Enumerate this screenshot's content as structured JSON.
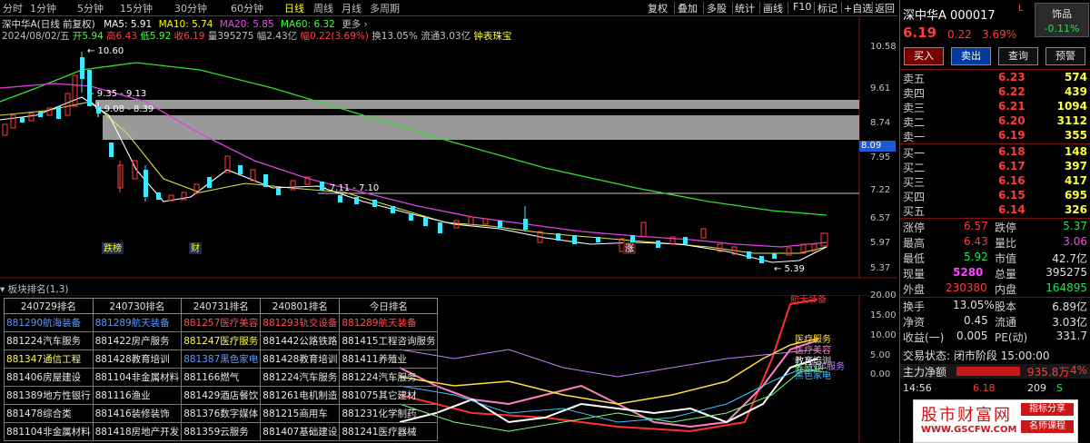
{
  "period_tabs": [
    "分时",
    "1分钟",
    "5分钟",
    "15分钟",
    "30分钟",
    "60分钟",
    "日线",
    "周线",
    "月线",
    "多周期"
  ],
  "active_period": "日线",
  "right_tools": [
    "复权",
    "叠加",
    "多股",
    "统计",
    "画线",
    "F10",
    "标记",
    "+自选",
    "返回"
  ],
  "header": {
    "title": "深中华A(日线 前复权)",
    "ma5": "MA5: 5.91",
    "ma10": "MA10: 5.74",
    "ma20": "MA20: 5.85",
    "ma60": "MA60: 6.32",
    "date": "2024/08/02/五",
    "open": "开5.94",
    "high": "高6.43",
    "low": "低5.92",
    "close": "收6.19",
    "vol": "量395275",
    "amp": "幅2.43亿",
    "chg": "幅0.22(3.69%)",
    "turnover": "换13.05%",
    "float": "流通3.03亿",
    "sector": "钟表珠宝"
  },
  "price_axis": [
    "10.58",
    "9.61",
    "8.74",
    "7.95",
    "7.22",
    "6.57",
    "5.97",
    "5.37"
  ],
  "current_price_tag": "8.09",
  "annotations": {
    "high_label": "10.60",
    "gap1": "9.35 - 9.13",
    "gap2": "9.08 - 8.39",
    "gap3": "7.11 - 7.10",
    "low_label": "5.39"
  },
  "markers": [
    "跌榜",
    "财",
    "涨"
  ],
  "lower_title": "板块排名(1,3)",
  "lower_axis": [
    "20.00",
    "15.00",
    "10.00",
    "5.00",
    "0.00"
  ],
  "rank_table": {
    "headers": [
      "240729排名",
      "240730排名",
      "240731排名",
      "240801排名",
      "今日排名"
    ],
    "rows": [
      [
        "881290航海装备",
        "881289航天装备",
        "881257医疗美容",
        "881293轨交设备",
        "881289航天装备"
      ],
      [
        "881224汽车服务",
        "881422房产服务",
        "881247医疗服务",
        "881442公路铁路",
        "881415工程咨询服务"
      ],
      [
        "881347通信工程",
        "881428教育培训",
        "881387黑色家电",
        "881428教育培训",
        "881411养殖业"
      ],
      [
        "881406房屋建设",
        "881104非金属材料",
        "881166燃气",
        "881224汽车服务",
        "881224汽车服务"
      ],
      [
        "881389地方性银行",
        "881116渔业",
        "881429酒店餐饮",
        "881261电机制造",
        "881075其它建材"
      ],
      [
        "881478综合类",
        "881416装修装饰",
        "881376数字媒体",
        "881215商用车",
        "881231化学制药"
      ],
      [
        "881104非金属材料",
        "881418房地产开发",
        "881359云服务",
        "881407基础建设",
        "881241医疗器械"
      ]
    ]
  },
  "line_labels": [
    "航天装备",
    "医疗服务",
    "医疗美容",
    "教育培训",
    "养殖业",
    "汽车服务",
    "黑色家电"
  ],
  "quote": {
    "name": "深中华A",
    "code": "000017",
    "flag": "L",
    "sector_name": "饰品",
    "sector_chg": "-0.11%",
    "price": "6.19",
    "change": "0.22",
    "pct": "3.69%",
    "buttons": [
      "买入",
      "卖出",
      "查询",
      "预警"
    ],
    "asks": [
      {
        "label": "卖五",
        "price": "6.23",
        "vol": "574"
      },
      {
        "label": "卖四",
        "price": "6.22",
        "vol": "439"
      },
      {
        "label": "卖三",
        "price": "6.21",
        "vol": "1094"
      },
      {
        "label": "卖二",
        "price": "6.20",
        "vol": "3112"
      },
      {
        "label": "卖一",
        "price": "6.19",
        "vol": "355"
      }
    ],
    "bids": [
      {
        "label": "买一",
        "price": "6.18",
        "vol": "148"
      },
      {
        "label": "买二",
        "price": "6.17",
        "vol": "397"
      },
      {
        "label": "买三",
        "price": "6.16",
        "vol": "417"
      },
      {
        "label": "买四",
        "price": "6.15",
        "vol": "695"
      },
      {
        "label": "买五",
        "price": "6.14",
        "vol": "326"
      }
    ],
    "stats": [
      {
        "l1": "涨停",
        "v1": "6.57",
        "l2": "跌停",
        "v2": "5.37"
      },
      {
        "l1": "最高",
        "v1": "6.43",
        "l2": "量比",
        "v2": "3.06"
      },
      {
        "l1": "最低",
        "v1": "5.92",
        "l2": "市值",
        "v2": "42.7亿"
      },
      {
        "l1": "现量",
        "v1": "5280",
        "l2": "总量",
        "v2": "395275"
      },
      {
        "l1": "外盘",
        "v1": "230380",
        "l2": "内盘",
        "v2": "164895"
      }
    ],
    "stats2": [
      {
        "l1": "换手",
        "v1": "13.05%",
        "l2": "股本",
        "v2": "6.89亿"
      },
      {
        "l1": "净资",
        "v1": "0.45",
        "l2": "流通",
        "v2": "3.03亿"
      },
      {
        "l1": "收益(一)",
        "v1": "0.005",
        "l2": "PE(动)",
        "v2": "331.7"
      }
    ],
    "status": "交易状态: 闭市阶段 15:00:00",
    "flow_label": "主力净额",
    "flow_value": "935.8万",
    "flow_pct": "4%",
    "tick": {
      "time": "14:56",
      "price": "6.18",
      "vol": "209",
      "side": "S"
    }
  },
  "watermark": {
    "title": "股市财富网",
    "url": "WWW.GSCFW.COM",
    "badge1": "指标分享",
    "badge2": "名师课程"
  }
}
